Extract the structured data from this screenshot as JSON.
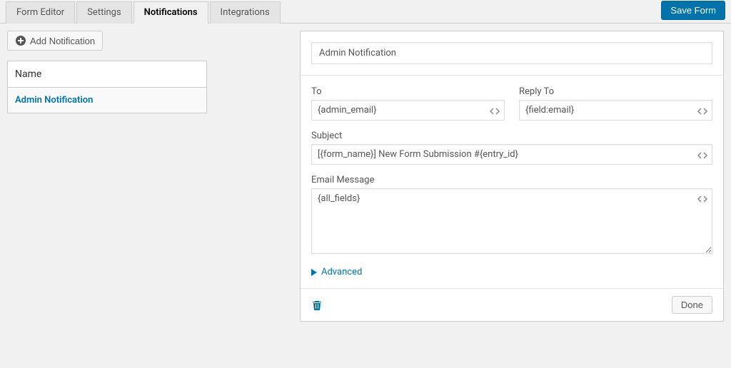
{
  "tabs": {
    "form_editor": "Form Editor",
    "settings": "Settings",
    "notifications": "Notifications",
    "integrations": "Integrations"
  },
  "save_button": "Save Form",
  "add_notification": "Add Notification",
  "list": {
    "header": "Name",
    "row1": "Admin Notification"
  },
  "editor": {
    "name_value": "Admin Notification",
    "to_label": "To",
    "to_value": "{admin_email}",
    "reply_to_label": "Reply To",
    "reply_to_value": "{field:email}",
    "subject_label": "Subject",
    "subject_value": "[{form_name}] New Form Submission #{entry_id}",
    "message_label": "Email Message",
    "message_value": "{all_fields}",
    "advanced": "Advanced",
    "done": "Done"
  }
}
